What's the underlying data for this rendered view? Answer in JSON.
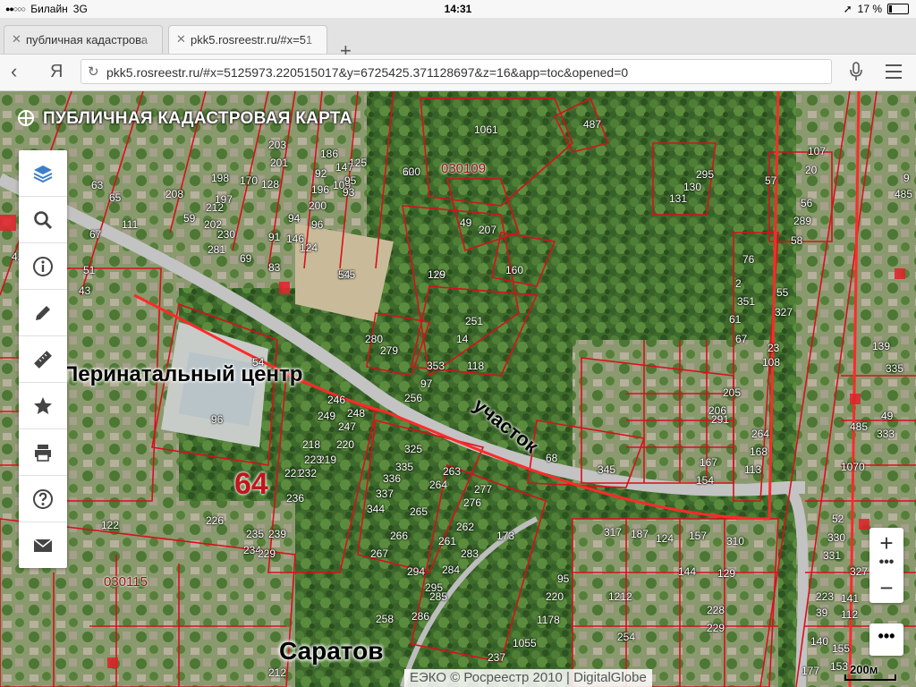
{
  "status": {
    "carrier": "Билайн",
    "network": "3G",
    "time": "14:31",
    "battery": "17 %"
  },
  "tabs": [
    {
      "title": "публичная кадастрова",
      "active": false
    },
    {
      "title": "pkk5.rosreestr.ru/#x=51",
      "active": true
    }
  ],
  "toolbar": {
    "back_icon": "back-arrow",
    "logo": "Я",
    "url": "pkk5.rosreestr.ru/#x=5125973.220515017&y=6725425.371128697&z=16&app=toc&opened=0"
  },
  "map": {
    "title": "ПУБЛИЧНАЯ КАДАСТРОВАЯ КАРТА",
    "labels": {
      "perinatal": "Перинатальный центр",
      "uchastok": "участок",
      "number64": "64",
      "city": "Саратов",
      "quarter1": "030109",
      "quarter2": "030115"
    },
    "parcels": [
      "120",
      "115",
      "116",
      "160",
      "251",
      "14",
      "118",
      "280",
      "279",
      "353",
      "97",
      "256",
      "54",
      "96",
      "246",
      "248",
      "249",
      "247",
      "218",
      "220",
      "219",
      "223",
      "221",
      "232",
      "236",
      "226",
      "235",
      "239",
      "234",
      "229",
      "122",
      "325",
      "335",
      "336",
      "337",
      "344",
      "263",
      "264",
      "265",
      "267",
      "266",
      "294",
      "295",
      "285",
      "284",
      "261",
      "283",
      "286",
      "276",
      "277",
      "262",
      "173",
      "258",
      "212",
      "237",
      "1055",
      "1178",
      "220",
      "95",
      "1212",
      "228",
      "229",
      "254",
      "205",
      "206",
      "291",
      "264",
      "168",
      "113",
      "167",
      "154",
      "68",
      "345",
      "317",
      "187",
      "124",
      "157",
      "310",
      "144",
      "129",
      "76",
      "2",
      "351",
      "61",
      "67",
      "55",
      "327",
      "23",
      "108",
      "295",
      "130",
      "131",
      "57",
      "56",
      "289",
      "58",
      "107",
      "20",
      "9",
      "485",
      "485",
      "333",
      "49",
      "52",
      "330",
      "331",
      "327",
      "223",
      "141",
      "39",
      "112",
      "140",
      "155",
      "177",
      "153",
      "139",
      "335",
      "1070",
      "487",
      "1061",
      "49",
      "207",
      "208",
      "212",
      "230",
      "202",
      "203",
      "201",
      "186",
      "92",
      "109",
      "125",
      "147",
      "170",
      "128",
      "198",
      "197",
      "93",
      "95",
      "196",
      "200",
      "96",
      "94",
      "124",
      "146",
      "91",
      "83",
      "69",
      "59",
      "281",
      "111",
      "61",
      "65",
      "67",
      "63",
      "43",
      "42",
      "45",
      "51",
      "60",
      "54",
      "129"
    ],
    "attribution": "ЕЭКО © Росреестр 2010 | DigitalGlobe",
    "scale": "200м"
  },
  "left_tools": [
    {
      "name": "layers-icon"
    },
    {
      "name": "search-icon"
    },
    {
      "name": "info-icon"
    },
    {
      "name": "pencil-icon"
    },
    {
      "name": "ruler-icon"
    },
    {
      "name": "star-icon"
    },
    {
      "name": "printer-icon"
    },
    {
      "name": "help-icon"
    },
    {
      "name": "mail-icon"
    }
  ],
  "zoom": {
    "in": "+",
    "out": "−",
    "more": "•••"
  },
  "colors": {
    "parcel": "#d8101b",
    "road": "#b9b9b9",
    "forest": "#2f5a20"
  }
}
